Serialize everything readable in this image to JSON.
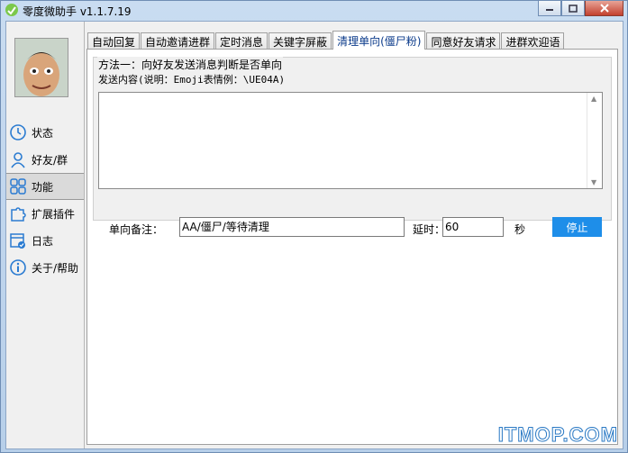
{
  "window": {
    "title": "零度微助手 v1.1.7.19"
  },
  "sidebar": {
    "items": [
      {
        "label": "状态",
        "icon": "clock-icon"
      },
      {
        "label": "好友/群",
        "icon": "user-icon"
      },
      {
        "label": "功能",
        "icon": "grid-icon",
        "active": true
      },
      {
        "label": "扩展插件",
        "icon": "puzzle-icon"
      },
      {
        "label": "日志",
        "icon": "calendar-icon"
      },
      {
        "label": "关于/帮助",
        "icon": "info-icon"
      }
    ]
  },
  "tabs": [
    {
      "label": "自动回复"
    },
    {
      "label": "自动邀请进群"
    },
    {
      "label": "定时消息"
    },
    {
      "label": "关键字屏蔽"
    },
    {
      "label": "清理单向(僵尸粉)",
      "active": true
    },
    {
      "label": "同意好友请求"
    },
    {
      "label": "进群欢迎语"
    }
  ],
  "panel": {
    "method_label": "方法一：向好友发送消息判断是否单向",
    "content_label": "发送内容(说明：Emoji表情例：\\UE04A)",
    "message_value": "",
    "remark_label": "单向备注：",
    "remark_value": "AA/僵尸/等待清理",
    "delay_label": "延时：",
    "delay_value": "60",
    "delay_unit": "秒",
    "stop_label": "停止"
  },
  "watermark": "ITMOP.COM",
  "colors": {
    "accent": "#1e8ee9",
    "active_tab_text": "#0a3a8a"
  }
}
